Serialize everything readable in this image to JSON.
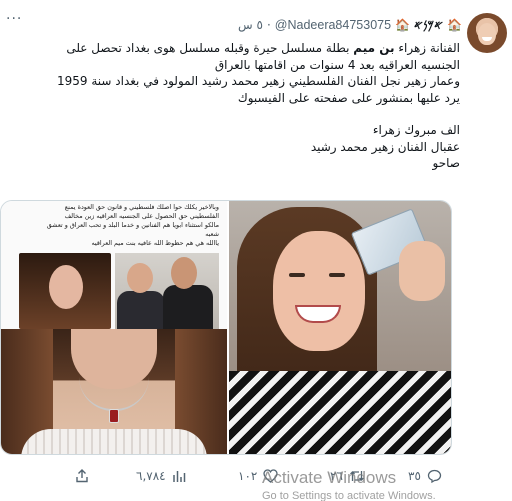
{
  "tweet": {
    "display_name": "𐤀𐤌𐤍𐤀",
    "badge_emoji": "🏠",
    "handle": "@Nadeera84753075",
    "separator": "·",
    "time": "٥ س",
    "more": "···",
    "body": {
      "line1_pre": "الفنانة زهراء ",
      "line1_mention": "بن ميم",
      "line1_post": " بطلة مسلسل حيرة وقبله مسلسل هوى بغداد تحصل على",
      "line2": "الجنسيه العراقيه بعد 4 سنوات من اقامتها بالعراق",
      "line3": "وعمار زهير نجل الفنان  الفلسطيني زهير محمد رشيد المولود في بغداد سنة 1959",
      "line4": "يرد عليها بمنشور على صفحته على الفيسبوك",
      "line5": "الف مبروك زهراء",
      "line6": "عقبال الفنان زهير محمد رشيد",
      "line7": "صاحو"
    },
    "media": {
      "article_lines": [
        "وبالاخير يكلك حوا اصلك فلسطيني و قانون حق العودة يمنع",
        "الفلسطيني حق الحصول على الجنسيه العراقيه زين مخالف",
        "مالكو استثناء ابويا هم الفنانين و خدما البلد و تحب العراق و تعشق",
        "شعبه",
        "ياالله هي هم حظوظ الله عافيه بنت ميم العراقيه"
      ]
    },
    "actions": {
      "replies": "٣٥",
      "retweets": "٢٦",
      "likes": "١٠٢",
      "views": "٦,٧٨٤",
      "share": ""
    }
  },
  "watermark": {
    "title": "Activate Windows",
    "subtitle": "Go to Settings to activate Windows."
  },
  "colors": {
    "text": "#0f1419",
    "muted": "#536471",
    "border": "#cfd9de"
  }
}
